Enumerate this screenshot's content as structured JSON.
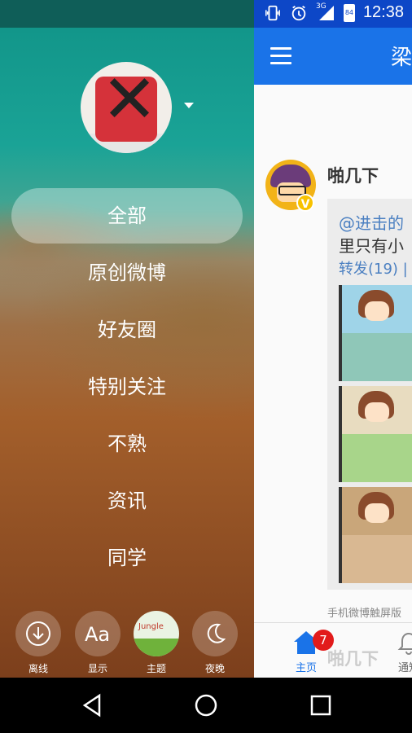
{
  "status_bar": {
    "time": "12:38",
    "network": "3G",
    "battery_level": "84",
    "icons": [
      "vibrate-icon",
      "alarm-icon",
      "signal-icon",
      "battery-icon"
    ]
  },
  "topbar": {
    "title": "梁"
  },
  "post": {
    "author": "啪几下",
    "verified_badge": "V",
    "repost_text_line1": "@进击的",
    "repost_text_line2": "里只有小",
    "repost_meta": "转发(19) |",
    "source": "手机微博触屏版"
  },
  "tabbar": {
    "home_label": "主页",
    "home_badge": "7",
    "notify_label": "通知",
    "ghost_text": "啪几下"
  },
  "drawer": {
    "menu": [
      {
        "label": "全部",
        "active": true
      },
      {
        "label": "原创微博",
        "active": false
      },
      {
        "label": "好友圈",
        "active": false
      },
      {
        "label": "特别关注",
        "active": false
      },
      {
        "label": "不熟",
        "active": false
      },
      {
        "label": "资讯",
        "active": false
      },
      {
        "label": "同学",
        "active": false
      }
    ],
    "actions": [
      {
        "label": "离线",
        "icon": "download-icon"
      },
      {
        "label": "显示",
        "icon": "font-size-icon"
      },
      {
        "label": "主题",
        "icon": "theme-icon"
      },
      {
        "label": "夜晚",
        "icon": "moon-icon"
      }
    ],
    "theme_thumb_text": "Jungle"
  },
  "colors": {
    "accent_blue": "#1a73e8",
    "badge_red": "#e21b1b",
    "link_blue": "#4a7fc1"
  }
}
